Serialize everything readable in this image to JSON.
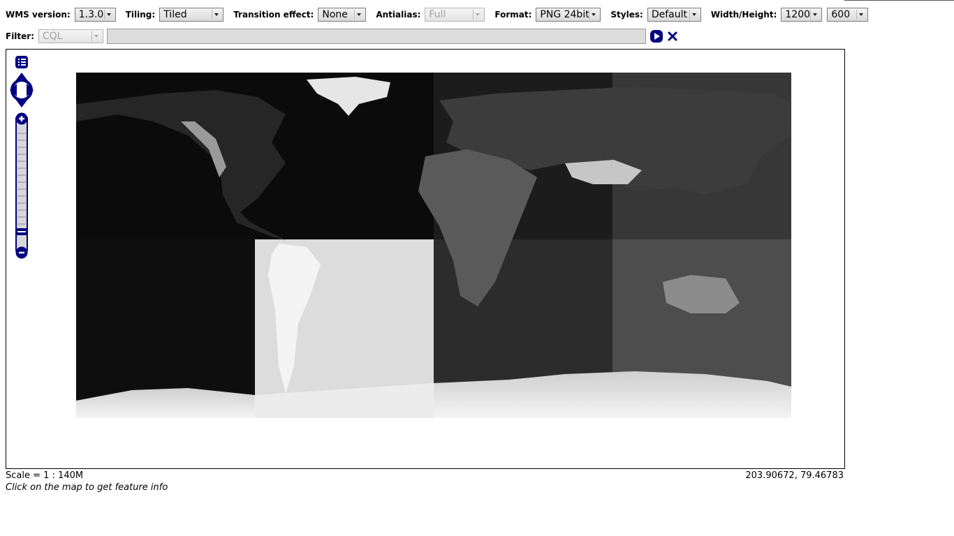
{
  "toolbar": {
    "wms_version": {
      "label": "WMS version:",
      "value": "1.3.0"
    },
    "tiling": {
      "label": "Tiling:",
      "value": "Tiled"
    },
    "transition": {
      "label": "Transition effect:",
      "value": "None"
    },
    "antialias": {
      "label": "Antialias:",
      "value": "Full"
    },
    "format": {
      "label": "Format:",
      "value": "PNG 24bit"
    },
    "styles": {
      "label": "Styles:",
      "value": "Default"
    },
    "size": {
      "label": "Width/Height:",
      "width": "1200",
      "height": "600"
    }
  },
  "filter": {
    "label": "Filter:",
    "type": "CQL",
    "value": ""
  },
  "status": {
    "scale": "Scale = 1 : 140M",
    "coordinates": "203.90672, 79.46783",
    "hint": "Click on the map to get feature info"
  },
  "icons": {
    "apply": "play-icon",
    "reset": "close-icon",
    "layers": "layer-list-icon",
    "pan": "pan-arrows-icon",
    "zoom_in": "plus-icon",
    "zoom_out": "minus-icon"
  },
  "colors": {
    "control": "#000080",
    "map_border": "#000000"
  }
}
